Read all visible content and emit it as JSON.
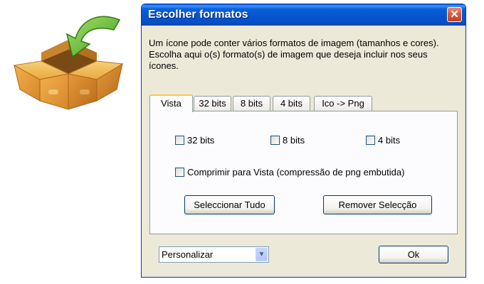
{
  "window": {
    "title": "Escolher formatos",
    "close_glyph": "✕"
  },
  "description": "Um ícone pode conter vários formatos de imagem (tamanhos e cores). Escolha aqui o(s) formato(s) de imagem que deseja incluir nos seus ícones.",
  "tabs": [
    {
      "label": "Vista",
      "active": true
    },
    {
      "label": "32 bits",
      "active": false
    },
    {
      "label": "8 bits",
      "active": false
    },
    {
      "label": "4 bits",
      "active": false
    },
    {
      "label": "Ico -> Png",
      "active": false
    }
  ],
  "panel": {
    "checkboxes": [
      {
        "label": "32 bits",
        "checked": false
      },
      {
        "label": "8 bits",
        "checked": false
      },
      {
        "label": "4 bits",
        "checked": false
      }
    ],
    "compress_checkbox": {
      "label": "Comprimir para Vista (compressão de png embutida)",
      "checked": false
    },
    "select_all_label": "Seleccionar Tudo",
    "remove_selection_label": "Remover Selecção"
  },
  "footer": {
    "preset_value": "Personalizar",
    "ok_label": "Ok"
  },
  "icons": {
    "install": "box-with-arrow-icon",
    "dropdown": "chevron-down-icon"
  },
  "colors": {
    "titlebar": "#0553cf",
    "close": "#d65a3e",
    "tab_highlight": "#ffc83c",
    "window_bg": "#ece9d8"
  }
}
